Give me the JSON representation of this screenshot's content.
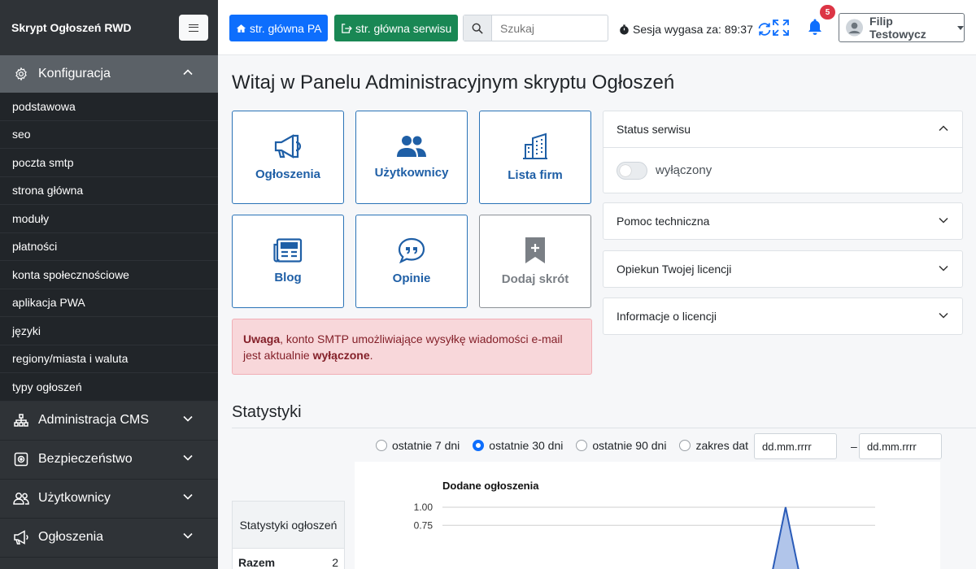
{
  "sidebar": {
    "brand": "Skrypt Ogłoszeń RWD",
    "open_section": {
      "label": "Konfiguracja",
      "icon": "gear-icon"
    },
    "sub_items": [
      "podstawowa",
      "seo",
      "poczta smtp",
      "strona główna",
      "moduły",
      "płatności",
      "konta społecznościowe",
      "aplikacja PWA",
      "języki",
      "regiony/miasta i waluta",
      "typy ogłoszeń"
    ],
    "sections": [
      {
        "label": "Administracja CMS",
        "icon": "sitemap-icon"
      },
      {
        "label": "Bezpieczeństwo",
        "icon": "shield-icon"
      },
      {
        "label": "Użytkownicy",
        "icon": "users-icon"
      },
      {
        "label": "Ogłoszenia",
        "icon": "megaphone-icon"
      }
    ]
  },
  "topbar": {
    "btn_pa": "str. główna PA",
    "btn_site": "str. główna serwisu",
    "search_placeholder": "Szukaj",
    "session": "Sesja wygasa za: 89:37",
    "notifications": "5",
    "user": "Filip Testowycz"
  },
  "main": {
    "title": "Witaj w Panelu Administracyjnym skryptu Ogłoszeń",
    "tiles": [
      {
        "label": "Ogłoszenia",
        "icon": "megaphone-icon"
      },
      {
        "label": "Użytkownicy",
        "icon": "users-icon"
      },
      {
        "label": "Lista firm",
        "icon": "building-icon"
      },
      {
        "label": "Blog",
        "icon": "newspaper-icon"
      },
      {
        "label": "Opinie",
        "icon": "quote-bubble-icon"
      },
      {
        "label": "Dodaj skrót",
        "icon": "bookmark-plus-icon"
      }
    ],
    "alert": {
      "strong1": "Uwaga",
      "text1": ", konto SMTP umożliwiające wysyłkę wiadomości e-mail jest aktualnie ",
      "strong2": "wyłączone",
      "text2": "."
    },
    "accordion": {
      "status_title": "Status serwisu",
      "status_value": "wyłączony",
      "help": "Pomoc techniczna",
      "guardian": "Opiekun Twojej licencji",
      "license": "Informacje o licencji"
    },
    "stats": {
      "title": "Statystyki",
      "ranges": [
        "ostatnie 7 dni",
        "ostatnie 30 dni",
        "ostatnie 90 dni",
        "zakres dat"
      ],
      "selected_range": "ostatnie 30 dni",
      "date_from_placeholder": "dd.mm.rrrr",
      "date_to_placeholder": "dd.mm.rrrr",
      "table_header": "Statystyki ogłoszeń",
      "table_row_label": "Razem",
      "table_row_value": "2"
    }
  },
  "colors": {
    "primary": "#0d6efd",
    "success": "#198754",
    "sidebar": "#2f3337",
    "danger": "#dc3545"
  },
  "chart_data": {
    "type": "area",
    "title": "Dodane ogłoszenia",
    "yticks": [
      "1.00",
      "0.75"
    ],
    "ylim": [
      0,
      1
    ],
    "series": [
      {
        "values": [
          0,
          0,
          0,
          0,
          0,
          0,
          0,
          0,
          0,
          0,
          0,
          0,
          0,
          0,
          0,
          0,
          0,
          0,
          0,
          0,
          0,
          0,
          0,
          1,
          0,
          0,
          0,
          0,
          0,
          0
        ]
      }
    ]
  }
}
